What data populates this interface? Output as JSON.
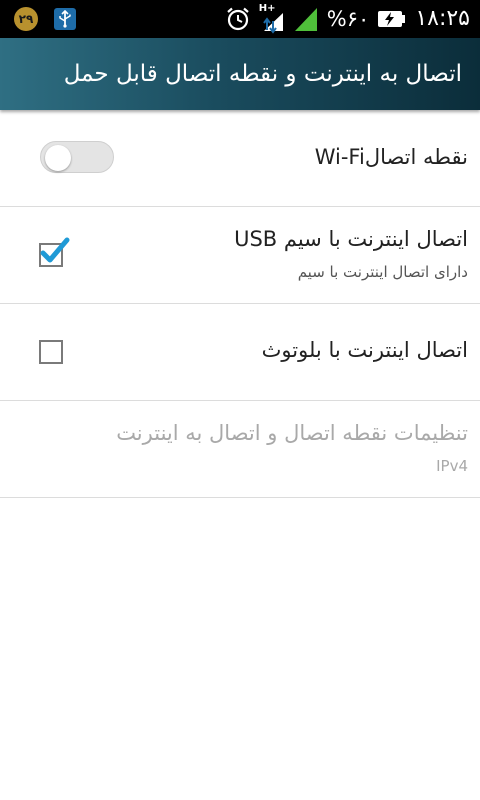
{
  "status_bar": {
    "notification_badge": "۲۹",
    "network_type": "H+",
    "battery_percent": "%۶۰",
    "time": "۱۸:۲۵",
    "icons": [
      "usb-debug-icon",
      "alarm-icon",
      "data-arrows-icon",
      "signal-icon",
      "battery-charging-icon"
    ]
  },
  "action_bar": {
    "title": "اتصال به اینترنت و نقطه اتصال قابل حمل"
  },
  "preferences": [
    {
      "title": "نقطه اتصالWi-Fi",
      "control": "toggle",
      "checked": false
    },
    {
      "title": "اتصال اینترنت با سیم USB",
      "summary": "دارای اتصال اینترنت با سیم",
      "control": "checkbox",
      "checked": true
    },
    {
      "title": "اتصال اینترنت با بلوتوث",
      "control": "checkbox",
      "checked": false
    },
    {
      "title": "تنظیمات نقطه اتصال و اتصال به اینترنت",
      "summary": "IPv4",
      "control": "none",
      "enabled": false
    }
  ],
  "colors": {
    "status_bar_bg": "#000000",
    "action_bar_start": "#2f6f83",
    "action_bar_end": "#0b2d3a",
    "check_accent": "#1f9ad6",
    "divider": "#dcdcdc",
    "disabled_text": "#a9a9a9"
  }
}
